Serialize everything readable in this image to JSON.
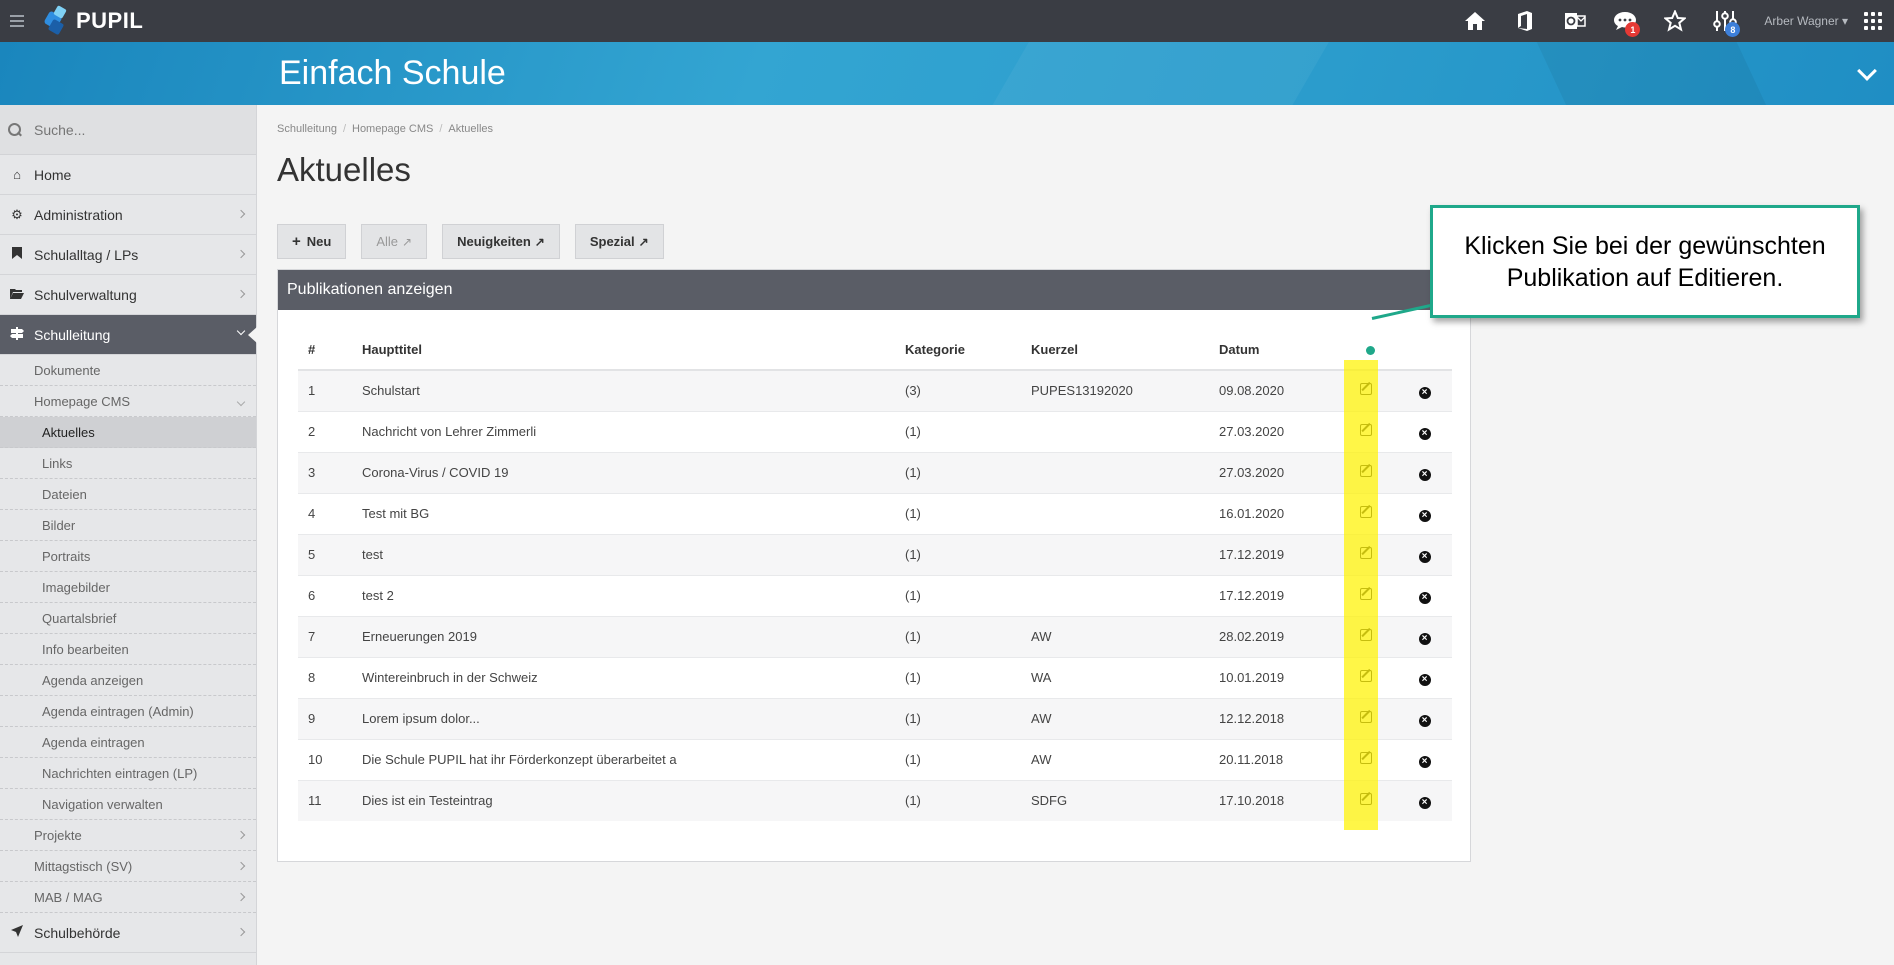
{
  "topbar": {
    "logo_text": "PUPIL",
    "user_name": "Arber Wagner",
    "chat_badge": "1",
    "settings_badge": "8"
  },
  "header": {
    "site_title": "Einfach Schule"
  },
  "sidebar": {
    "search_placeholder": "Suche...",
    "items": [
      {
        "label": "Home"
      },
      {
        "label": "Administration"
      },
      {
        "label": "Schulalltag / LPs"
      },
      {
        "label": "Schulverwaltung"
      },
      {
        "label": "Schulleitung"
      },
      {
        "label": "Dokumente"
      },
      {
        "label": "Homepage CMS"
      },
      {
        "label": "Aktuelles"
      },
      {
        "label": "Links"
      },
      {
        "label": "Dateien"
      },
      {
        "label": "Bilder"
      },
      {
        "label": "Portraits"
      },
      {
        "label": "Imagebilder"
      },
      {
        "label": "Quartalsbrief"
      },
      {
        "label": "Info bearbeiten"
      },
      {
        "label": "Agenda anzeigen"
      },
      {
        "label": "Agenda eintragen (Admin)"
      },
      {
        "label": "Agenda eintragen"
      },
      {
        "label": "Nachrichten eintragen (LP)"
      },
      {
        "label": "Navigation verwalten"
      },
      {
        "label": "Projekte"
      },
      {
        "label": "Mittagstisch (SV)"
      },
      {
        "label": "MAB / MAG"
      },
      {
        "label": "Schulbehörde"
      }
    ]
  },
  "breadcrumb": [
    "Schulleitung",
    "Homepage CMS",
    "Aktuelles"
  ],
  "page": {
    "title": "Aktuelles"
  },
  "buttons": {
    "neu": "Neu",
    "alle": "Alle",
    "neuigkeiten": "Neuigkeiten",
    "spezial": "Spezial"
  },
  "panel": {
    "title": "Publikationen anzeigen"
  },
  "table": {
    "headers": {
      "num": "#",
      "title": "Haupttitel",
      "kat": "Kategorie",
      "kurz": "Kuerzel",
      "date": "Datum"
    },
    "rows": [
      {
        "num": "1",
        "title": "Schulstart",
        "kat": "(3)",
        "kurz": "PUPES13192020",
        "date": "09.08.2020"
      },
      {
        "num": "2",
        "title": "Nachricht von Lehrer Zimmerli",
        "kat": "(1)",
        "kurz": "",
        "date": "27.03.2020"
      },
      {
        "num": "3",
        "title": "Corona-Virus / COVID 19",
        "kat": "(1)",
        "kurz": "",
        "date": "27.03.2020"
      },
      {
        "num": "4",
        "title": "Test mit BG",
        "kat": "(1)",
        "kurz": "",
        "date": "16.01.2020"
      },
      {
        "num": "5",
        "title": "test",
        "kat": "(1)",
        "kurz": "",
        "date": "17.12.2019"
      },
      {
        "num": "6",
        "title": "test 2",
        "kat": "(1)",
        "kurz": "",
        "date": "17.12.2019"
      },
      {
        "num": "7",
        "title": "Erneuerungen 2019",
        "kat": "(1)",
        "kurz": "AW",
        "date": "28.02.2019"
      },
      {
        "num": "8",
        "title": "Wintereinbruch in der Schweiz",
        "kat": "(1)",
        "kurz": "WA",
        "date": "10.01.2019"
      },
      {
        "num": "9",
        "title": "Lorem ipsum dolor...",
        "kat": "(1)",
        "kurz": "AW",
        "date": "12.12.2018"
      },
      {
        "num": "10",
        "title": "Die Schule PUPIL hat ihr Förderkonzept überarbeitet a",
        "kat": "(1)",
        "kurz": "AW",
        "date": "20.11.2018"
      },
      {
        "num": "11",
        "title": "Dies ist ein Testeintrag",
        "kat": "(1)",
        "kurz": "SDFG",
        "date": "17.10.2018"
      }
    ]
  },
  "callout": {
    "text": "Klicken Sie bei der gewünschten Publikation auf Editieren."
  },
  "colors": {
    "accent_blue": "#2b9ccc",
    "dark_bar": "#3a3d44",
    "panel_head": "#5a5d66",
    "highlight_yellow": "#fff200",
    "callout_green": "#1fa88a"
  }
}
